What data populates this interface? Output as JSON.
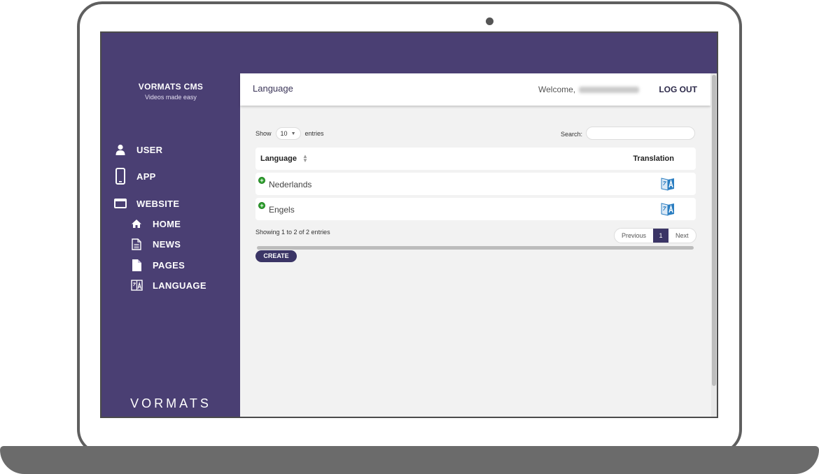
{
  "brand": {
    "name": "VORMATS CMS",
    "tagline": "Videos made easy",
    "logo_text": "VORMATS"
  },
  "sidebar": {
    "items": [
      {
        "label": "USER",
        "icon": "user-icon"
      },
      {
        "label": "APP",
        "icon": "mobile-icon"
      },
      {
        "label": "WEBSITE",
        "icon": "window-icon"
      }
    ],
    "subitems": [
      {
        "label": "HOME",
        "icon": "home-icon"
      },
      {
        "label": "NEWS",
        "icon": "document-icon"
      },
      {
        "label": "PAGES",
        "icon": "page-icon"
      },
      {
        "label": "LANGUAGE",
        "icon": "translate-icon"
      }
    ]
  },
  "header": {
    "title": "Language",
    "welcome": "Welcome,",
    "logout": "LOG OUT"
  },
  "table_controls": {
    "show": "Show",
    "page_length": "10",
    "entries": "entries",
    "search_label": "Search:",
    "search_value": ""
  },
  "table": {
    "columns": [
      "Language",
      "Translation"
    ],
    "rows": [
      {
        "language": "Nederlands"
      },
      {
        "language": "Engels"
      }
    ]
  },
  "footer": {
    "info": "Showing 1 to 2 of 2 entries",
    "prev": "Previous",
    "page": "1",
    "next": "Next",
    "create": "CREATE"
  },
  "colors": {
    "sidebar": "#4a3f73",
    "accent": "#3b3566",
    "add": "#2ca02c",
    "translate": "#2b7ec1"
  }
}
